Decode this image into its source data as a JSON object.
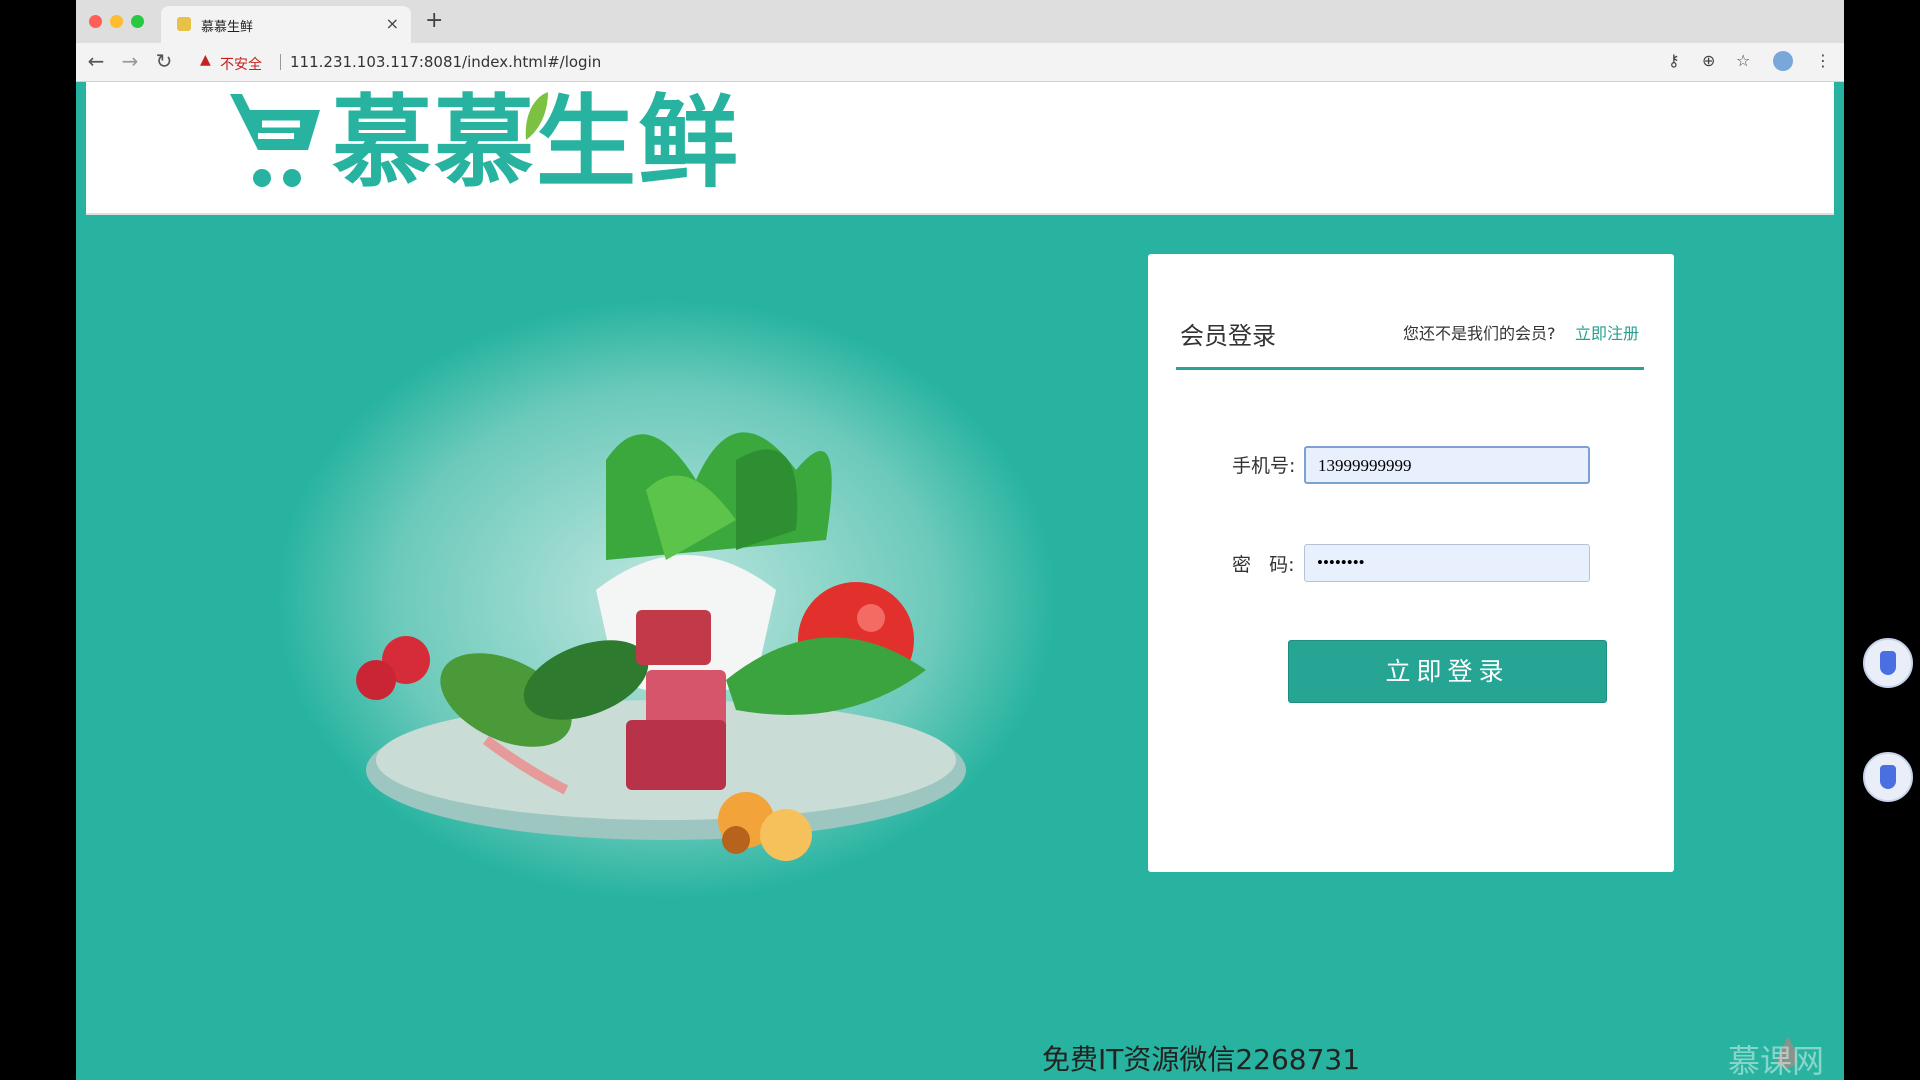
{
  "browser": {
    "tab_title": "慕慕生鲜",
    "tab_close": "×",
    "new_tab": "+",
    "security_warning": "不安全",
    "url": "111.231.103.117:8081/index.html#/login",
    "nav": {
      "back": "←",
      "forward": "→",
      "reload": "↻"
    },
    "icons": [
      "key-icon",
      "zoom-icon",
      "star-icon",
      "avatar",
      "menu-icon"
    ],
    "toolbar_glyphs": {
      "key": "⚷",
      "zoom": "⊕",
      "star": "☆",
      "menu": "⋮",
      "warn": "▲"
    }
  },
  "header": {
    "logo_text": "慕慕生鲜",
    "brand_color": "#27b3a0"
  },
  "login": {
    "title": "会员登录",
    "register_prompt": "您还不是我们的会员?",
    "register_link": "立即注册",
    "phone_label": "手机号:",
    "phone_value": "13999999999",
    "password_label": "密   码:",
    "password_value": "••••••••",
    "submit_label": "立即登录"
  },
  "footer": {
    "watermark": "免费IT资源微信2268731",
    "brand": "慕课网"
  },
  "colors": {
    "page_background": "#27b3a0",
    "accent": "#26a594",
    "warning": "#c5221f"
  }
}
